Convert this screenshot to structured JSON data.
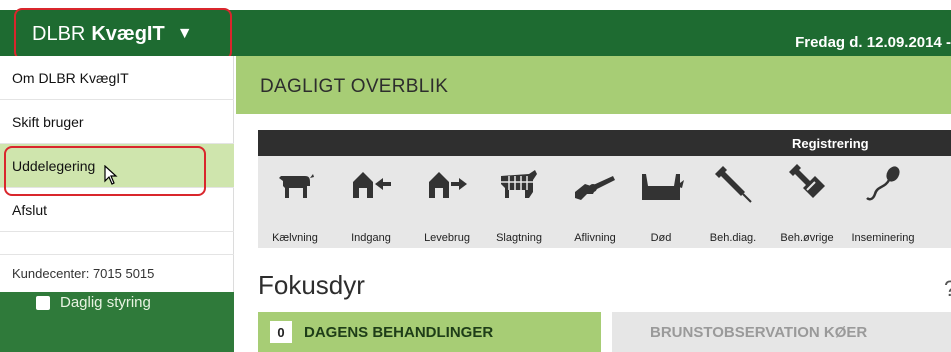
{
  "brand": {
    "prefix": "DLBR",
    "name": "KvægIT",
    "caret": "▼"
  },
  "header": {
    "date": "Fredag d. 12.09.2014 -"
  },
  "menu": {
    "items": [
      {
        "label": "Om DLBR KvægIT"
      },
      {
        "label": "Skift bruger"
      },
      {
        "label": "Uddelegering",
        "highlighted": true
      },
      {
        "label": "Afslut"
      }
    ],
    "footer": "Kundecenter: 7015 5015"
  },
  "sidenav": {
    "item": "Daglig styring"
  },
  "page": {
    "title": "DAGLIGT OVERBLIK"
  },
  "registrering": {
    "label": "Registrering",
    "icons": [
      {
        "name": "cow-icon",
        "label": "Kælvning"
      },
      {
        "name": "barn-in-icon",
        "label": "Indgang"
      },
      {
        "name": "barn-out-icon",
        "label": "Levebrug"
      },
      {
        "name": "carcass-icon",
        "label": "Slagtning"
      },
      {
        "name": "pistol-icon",
        "label": "Aflivning"
      },
      {
        "name": "dead-cow-icon",
        "label": "Død"
      },
      {
        "name": "syringe-icon",
        "label": "Beh.diag."
      },
      {
        "name": "syringe-bandage-icon",
        "label": "Beh.øvrige"
      },
      {
        "name": "sperm-icon",
        "label": "Inseminering"
      }
    ]
  },
  "fokusdyr": {
    "title": "Fokusdyr",
    "help": "?",
    "tab_active": {
      "count": "0",
      "label": "DAGENS BEHANDLINGER"
    },
    "tab_inactive": {
      "label": "BRUNSTOBSERVATION KØER"
    }
  },
  "colors": {
    "dark_green": "#1e6b31",
    "light_green": "#a7cd75",
    "highlight": "#cfe5ad",
    "annotation_red": "#d9262c"
  }
}
